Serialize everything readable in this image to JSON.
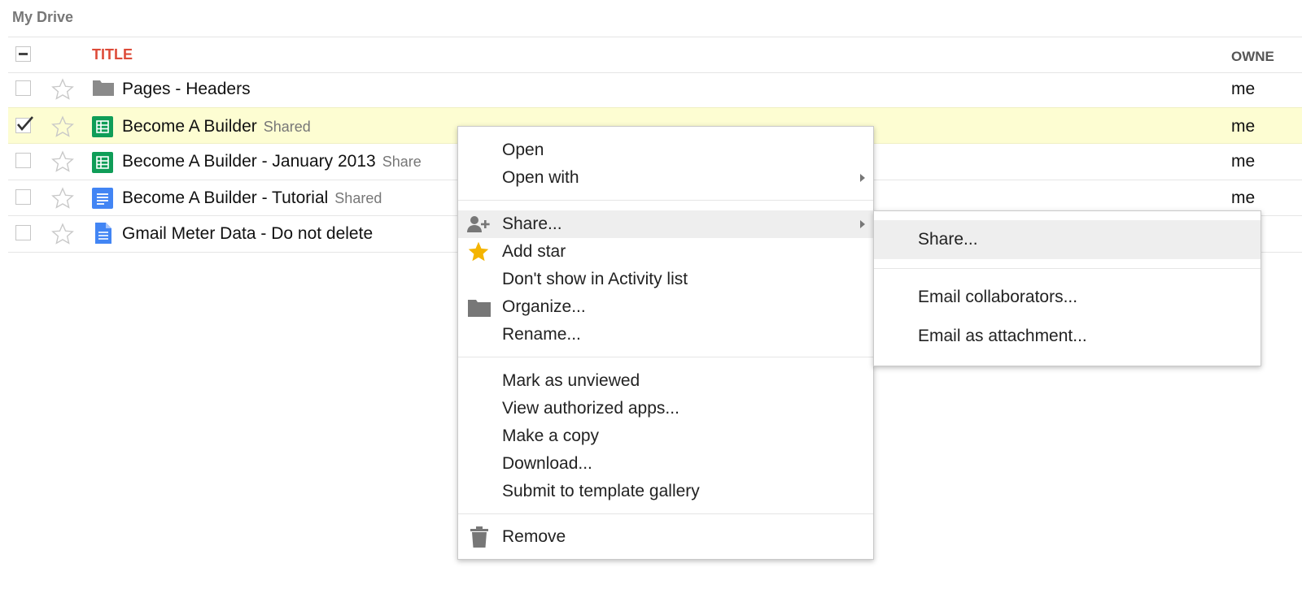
{
  "breadcrumb": "My Drive",
  "columns": {
    "title": "TITLE",
    "owner": "OWNE"
  },
  "files": [
    {
      "name": "Pages - Headers",
      "shared": "",
      "type": "folder-icon",
      "owner": "me",
      "checked": false
    },
    {
      "name": "Become A Builder",
      "shared": "Shared",
      "type": "spreadsheet-icon",
      "owner": "me",
      "checked": true
    },
    {
      "name": "Become A Builder - January 2013",
      "shared": "Share",
      "type": "spreadsheet-icon",
      "owner": "me",
      "checked": false
    },
    {
      "name": "Become A Builder - Tutorial",
      "shared": "Shared",
      "type": "document-icon",
      "owner": "me",
      "checked": false
    },
    {
      "name": "Gmail Meter Data - Do not delete",
      "shared": "",
      "type": "file-icon",
      "owner": "",
      "checked": false
    }
  ],
  "context_menu": {
    "open": "Open",
    "open_with": "Open with",
    "share": "Share...",
    "add_star": "Add star",
    "dont_show_activity": "Don't show in Activity list",
    "organize": "Organize...",
    "rename": "Rename...",
    "mark_unviewed": "Mark as unviewed",
    "view_apps": "View authorized apps...",
    "make_copy": "Make a copy",
    "download": "Download...",
    "submit_template": "Submit to template gallery",
    "remove": "Remove"
  },
  "share_submenu": {
    "share": "Share...",
    "email_collaborators": "Email collaborators...",
    "email_attachment": "Email as attachment..."
  },
  "colors": {
    "title_header": "#dd4b39",
    "selected_row": "#fdfdd2",
    "sheets_green": "#0f9d58",
    "docs_blue": "#4285f4",
    "star_gold": "#f4b400",
    "menu_highlight": "#eeeeee"
  }
}
